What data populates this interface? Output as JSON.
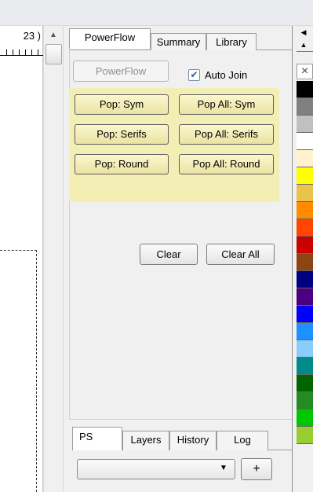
{
  "canvas": {
    "coordinate_text": "23 )"
  },
  "docker": {
    "tabs": [
      {
        "label": "PowerFlow"
      },
      {
        "label": "Summary"
      },
      {
        "label": "Library"
      }
    ],
    "powerflow_button": "PowerFlow",
    "auto_join": {
      "label": "Auto Join",
      "checked": true
    },
    "pop_buttons": {
      "pop_sym": "Pop: Sym",
      "pop_all_sym": "Pop All: Sym",
      "pop_serifs": "Pop: Serifs",
      "pop_all_serifs": "Pop All: Serifs",
      "pop_round": "Pop: Round",
      "pop_all_round": "Pop All: Round"
    },
    "clear_button": "Clear",
    "clear_all_button": "Clear All",
    "bottom_tabs": [
      {
        "label": "PS"
      },
      {
        "label": "Layers"
      },
      {
        "label": "History"
      },
      {
        "label": "Log"
      }
    ],
    "dropdown_value": "",
    "plus_button": "+"
  },
  "palette": {
    "none_swatch": "×",
    "colors": [
      "#000000",
      "#808080",
      "#c0c0c0",
      "#ffffff",
      "#fff2cc",
      "#ffff00",
      "#e8c44a",
      "#ff8c00",
      "#ff4500",
      "#cc0000",
      "#8b4513",
      "#000080",
      "#4b0082",
      "#0000ff",
      "#1e90ff",
      "#87cefa",
      "#008b8b",
      "#006400",
      "#228b22",
      "#00c800",
      "#9acd32"
    ]
  },
  "colors": {
    "accent_yellow": "#f3efb4",
    "checkmark": "#2a5fa6"
  }
}
